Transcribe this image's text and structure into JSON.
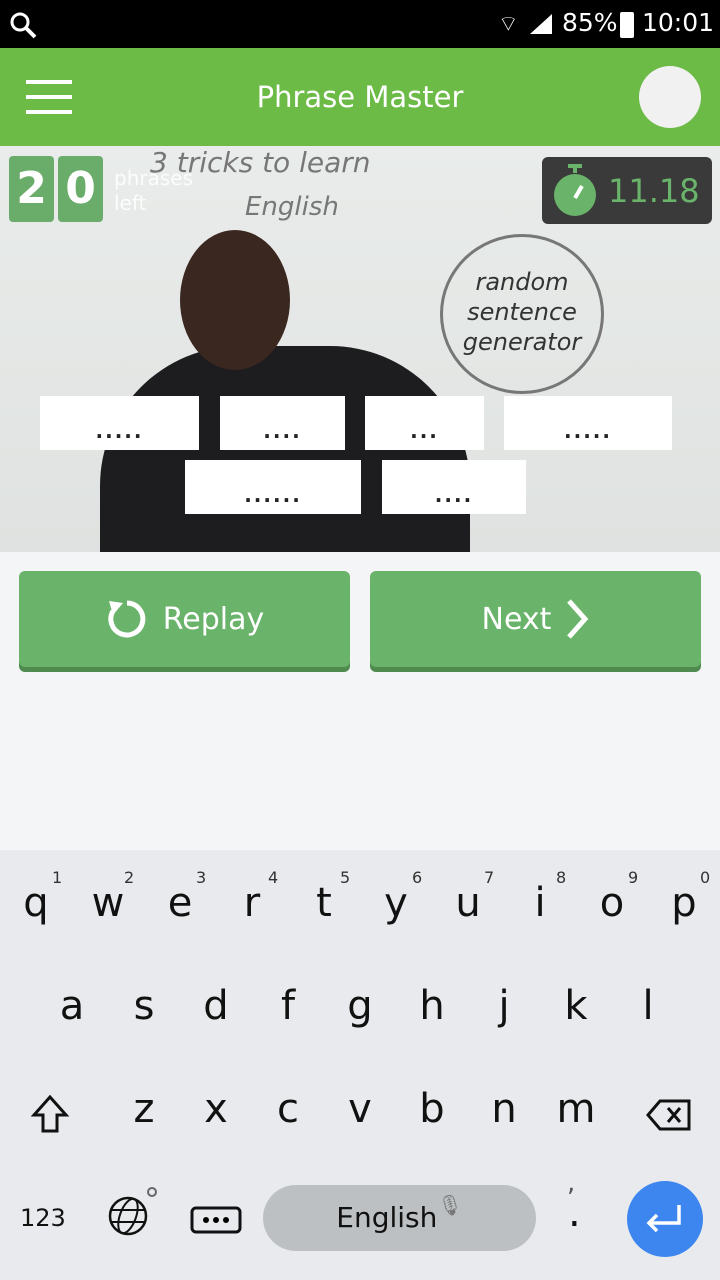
{
  "status": {
    "battery": "85%",
    "time": "10:01"
  },
  "header": {
    "title": "Phrase Master"
  },
  "counter": {
    "digits": [
      "2",
      "0"
    ],
    "label_line1": "phrases",
    "label_line2": "left"
  },
  "timer": {
    "value": "11.18"
  },
  "video": {
    "board_line1": "3 tricks to learn",
    "board_line2": "English",
    "board_circle": "random sentence generator"
  },
  "pieces": [
    ".....",
    "....",
    "...",
    ".....",
    "......",
    "...."
  ],
  "actions": {
    "replay": "Replay",
    "next": "Next"
  },
  "keyboard": {
    "row1": [
      "q",
      "w",
      "e",
      "r",
      "t",
      "y",
      "u",
      "i",
      "o",
      "p"
    ],
    "row1_nums": [
      "1",
      "2",
      "3",
      "4",
      "5",
      "6",
      "7",
      "8",
      "9",
      "0"
    ],
    "row2": [
      "a",
      "s",
      "d",
      "f",
      "g",
      "h",
      "j",
      "k",
      "l"
    ],
    "row3": [
      "z",
      "x",
      "c",
      "v",
      "b",
      "n",
      "m"
    ],
    "numbers_key": "123",
    "space_label": "English",
    "period": ".",
    "comma": ",",
    "accent": "#3d86f0"
  },
  "colors": {
    "brand": "#6dbb47",
    "button": "#6ab36a"
  }
}
